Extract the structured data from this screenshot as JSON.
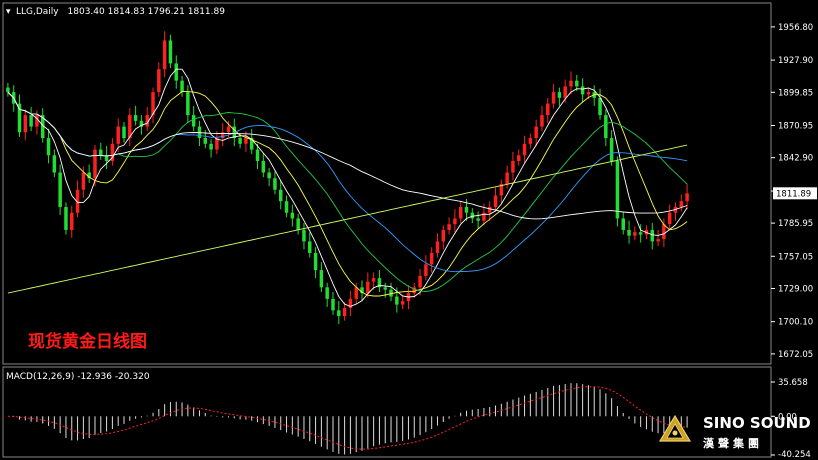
{
  "colors": {
    "up": "#ff2020",
    "down": "#22dd33",
    "ma5": "#ffffff",
    "ma10": "#ffff44",
    "ma20": "#22cc44",
    "ma30": "#3399ff",
    "ma60": "#ffffff",
    "ma120": "#ccff66",
    "macd_hist": "#dddddd",
    "macd_signal": "#ff2020"
  },
  "header": {
    "symbol": "LLG,Daily",
    "ohlc": "1803.40 1814.83 1796.21 1811.89"
  },
  "overlay_title": "现货黄金日线图",
  "macd": {
    "label": "MACD(12,26,9) -12.936 -20.320",
    "ticks": [
      "35.658",
      "0.00",
      "-40.254"
    ]
  },
  "brand": {
    "name": "SINO SOUND",
    "sub": "漢聲集團",
    "logo": "logo-icon"
  },
  "chart_data": {
    "type": "candlestick",
    "title": "",
    "ylim": [
      1665,
      1975
    ],
    "yticks": [
      1956.8,
      1927.9,
      1899.85,
      1870.95,
      1842.9,
      1813.85,
      1785.95,
      1757.05,
      1729.0,
      1700.1,
      1672.05
    ],
    "current_price": "1811.89",
    "closes": [
      1900,
      1890,
      1865,
      1880,
      1870,
      1880,
      1860,
      1845,
      1830,
      1800,
      1780,
      1795,
      1815,
      1830,
      1825,
      1850,
      1845,
      1840,
      1855,
      1870,
      1860,
      1880,
      1875,
      1870,
      1880,
      1900,
      1920,
      1945,
      1925,
      1910,
      1900,
      1880,
      1870,
      1860,
      1855,
      1850,
      1860,
      1865,
      1870,
      1860,
      1855,
      1860,
      1850,
      1840,
      1830,
      1825,
      1815,
      1805,
      1795,
      1790,
      1780,
      1770,
      1760,
      1745,
      1730,
      1720,
      1710,
      1705,
      1712,
      1720,
      1730,
      1725,
      1735,
      1738,
      1730,
      1728,
      1722,
      1715,
      1718,
      1725,
      1730,
      1740,
      1750,
      1760,
      1770,
      1780,
      1785,
      1790,
      1800,
      1795,
      1790,
      1788,
      1795,
      1800,
      1810,
      1820,
      1830,
      1840,
      1845,
      1855,
      1860,
      1870,
      1880,
      1890,
      1900,
      1895,
      1905,
      1910,
      1905,
      1898,
      1900,
      1895,
      1880,
      1860,
      1840,
      1790,
      1780,
      1775,
      1778,
      1776,
      1780,
      1770,
      1772,
      1785,
      1795,
      1800,
      1805,
      1811.89
    ],
    "ma_periods": [
      5,
      10,
      20,
      30,
      60,
      120
    ],
    "macd_range": [
      -40.254,
      35.658
    ]
  }
}
